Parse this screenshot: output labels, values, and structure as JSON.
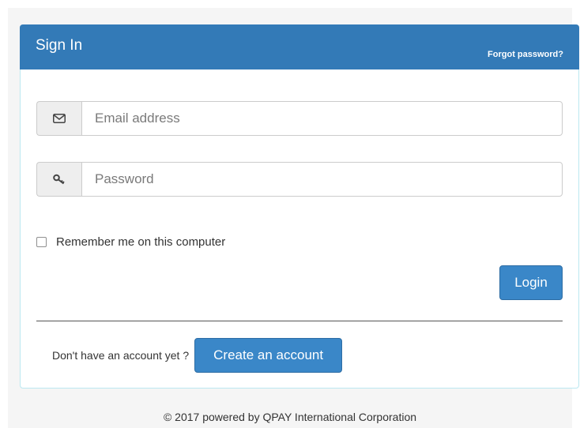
{
  "panel": {
    "title": "Sign In",
    "forgot_link": "Forgot password?"
  },
  "form": {
    "email_placeholder": "Email address",
    "email_icon": "envelope-icon",
    "password_placeholder": "Password",
    "password_icon": "key-icon",
    "remember_label": "Remember me on this computer",
    "remember_checked": false,
    "login_label": "Login"
  },
  "signup": {
    "prompt": "Don't have an account yet ?",
    "button_label": "Create an account"
  },
  "footer": {
    "text": "© 2017 powered by QPAY International Corporation"
  },
  "colors": {
    "heading_bg": "#337ab7",
    "button_bg": "#3a87c8",
    "panel_border": "#bce8f1"
  }
}
